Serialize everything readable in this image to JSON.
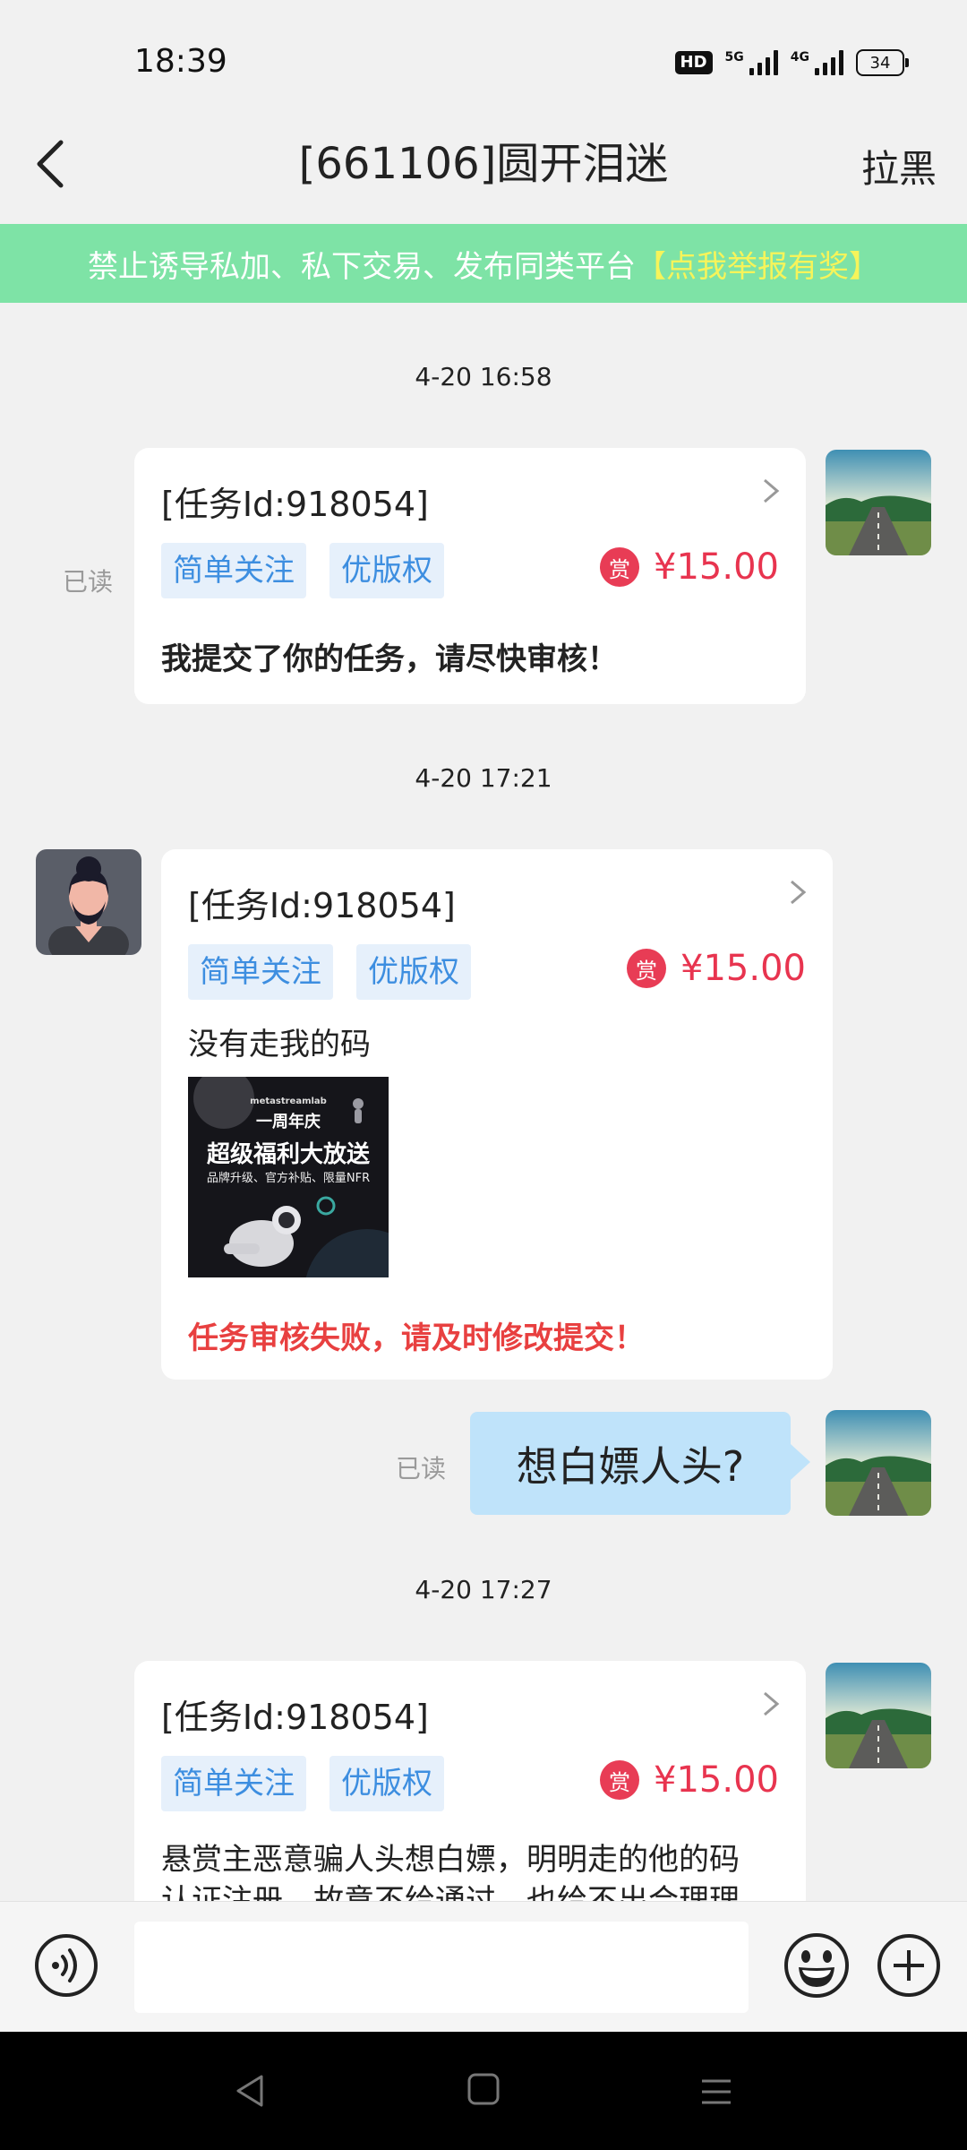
{
  "status_bar": {
    "time": "18:39",
    "hd": "HD",
    "net1": "5G",
    "net2": "4G",
    "battery": "34"
  },
  "header": {
    "title": "[661106]圆开泪迷",
    "block_label": "拉黑"
  },
  "banner": {
    "text": "禁止诱导私加、私下交易、发布同类平台",
    "report": "【点我举报有奖】"
  },
  "messages": [
    {
      "time": "4-20 16:58",
      "read": "已读",
      "task_id": "[任务Id:918054]",
      "tags": [
        "简单关注",
        "优版权"
      ],
      "reward_icon": "赏",
      "price": "¥15.00",
      "text": "我提交了你的任务，请尽快审核！"
    },
    {
      "time": "4-20 17:21",
      "task_id": "[任务Id:918054]",
      "tags": [
        "简单关注",
        "优版权"
      ],
      "reward_icon": "赏",
      "price": "¥15.00",
      "text": "没有走我的码",
      "image": {
        "brand": "metastreamlab",
        "line1": "一周年庆",
        "line2": "超级福利大放送",
        "line3": "品牌升级、官方补贴、限量NFR"
      },
      "status": "任务审核失败，请及时修改提交！"
    },
    {
      "read": "已读",
      "text": "想白嫖人头?"
    },
    {
      "time": "4-20 17:27",
      "task_id": "[任务Id:918054]",
      "tags": [
        "简单关注",
        "优版权"
      ],
      "reward_icon": "赏",
      "price": "¥15.00",
      "text_line1": "悬赏主恶意骗人头想白嫖，明明走的他的码",
      "text_line2": "认证注册，故意不给通过。也给不出合理理"
    }
  ],
  "input": {
    "placeholder": ""
  },
  "colors": {
    "accent_green": "#7ee3a6",
    "price_red": "#e8344f",
    "tag_blue": "#3d8ee0",
    "bubble_blue": "#bfe3fa"
  }
}
